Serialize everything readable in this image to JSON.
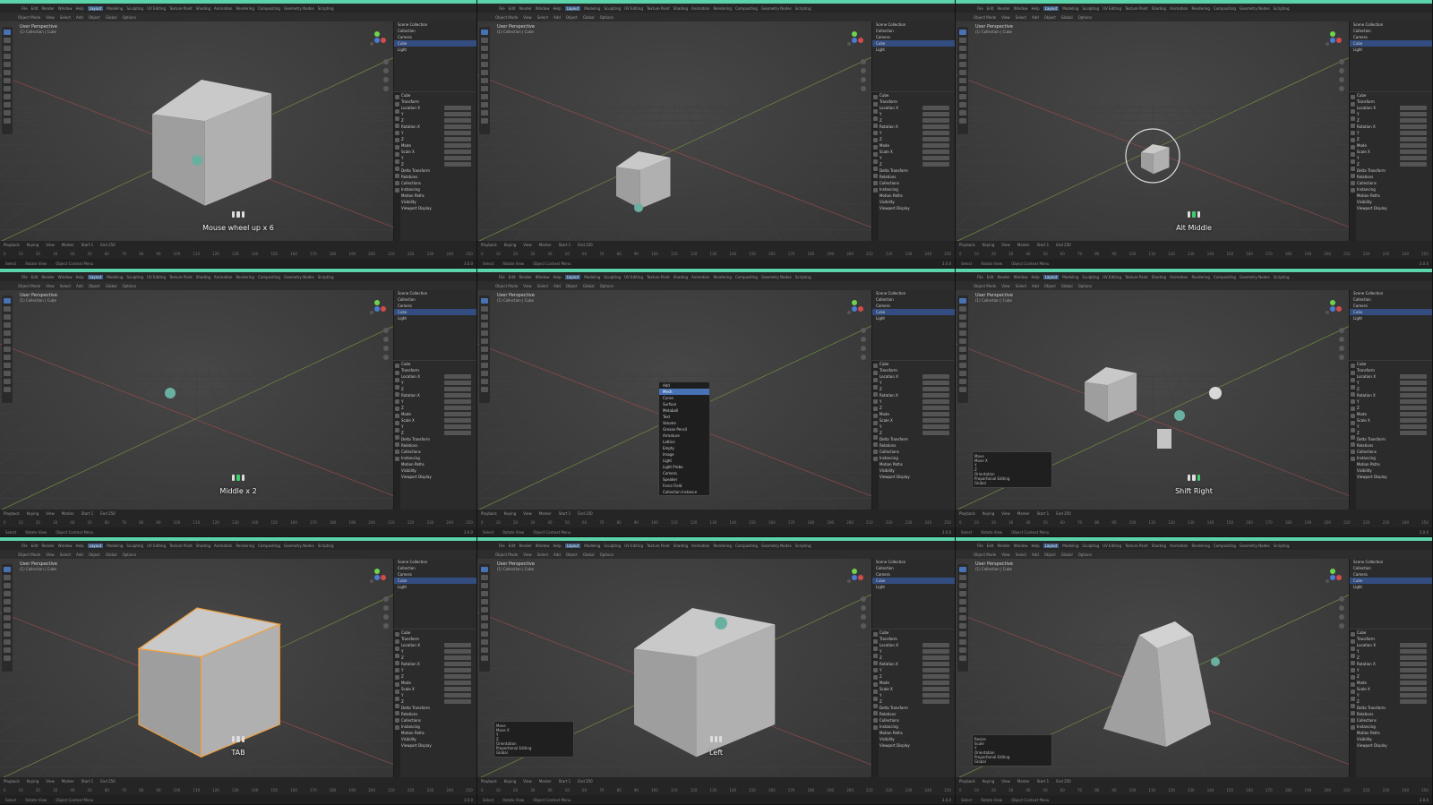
{
  "menus": [
    "File",
    "Edit",
    "Render",
    "Window",
    "Help"
  ],
  "workspaces": [
    "Layout",
    "Modeling",
    "Sculpting",
    "UV Editing",
    "Texture Paint",
    "Shading",
    "Animation",
    "Rendering",
    "Compositing",
    "Geometry Nodes",
    "Scripting"
  ],
  "active_workspace": "Layout",
  "header": {
    "mode": "Object Mode",
    "view": "View",
    "select": "Select",
    "add": "Add",
    "object": "Object",
    "orientation": "Global",
    "options": "Options"
  },
  "viewport": {
    "title": "User Perspective",
    "subtitle": "(1) Collection | Cube"
  },
  "outliner": {
    "header": "Scene Collection",
    "items": [
      "Collection",
      "Camera",
      "Cube",
      "Light"
    ]
  },
  "properties": {
    "object_name": "Cube",
    "section": "Transform",
    "rows": [
      "Location X",
      "Y",
      "Z",
      "Rotation X",
      "Y",
      "Z",
      "Mode",
      "Scale X",
      "Y",
      "Z"
    ],
    "subsections": [
      "Delta Transform",
      "Relations",
      "Collections",
      "Instancing",
      "Motion Paths",
      "Visibility",
      "Viewport Display"
    ]
  },
  "timeline": {
    "items": [
      "Playback",
      "Keying",
      "View",
      "Marker"
    ],
    "start": "Start 1",
    "end": "End 250",
    "frames": [
      "0",
      "10",
      "20",
      "30",
      "40",
      "50",
      "60",
      "70",
      "80",
      "90",
      "100",
      "110",
      "120",
      "130",
      "140",
      "150",
      "160",
      "170",
      "180",
      "190",
      "200",
      "210",
      "220",
      "230",
      "240",
      "250"
    ]
  },
  "statusbar": {
    "select": "Select",
    "rotate": "Rotate View",
    "context": "Object Context Menu",
    "version": "3.0.0"
  },
  "key_captions": {
    "p1": "Mouse wheel up x 6",
    "p3": "Alt Middle",
    "p4": "Middle x 2",
    "p6": "Shift Right",
    "p7": "TAB",
    "p8": "Left"
  },
  "add_menu": {
    "title": "Add",
    "items": [
      "Mesh",
      "Curve",
      "Surface",
      "Metaball",
      "Text",
      "Volume",
      "Grease Pencil",
      "Armature",
      "Lattice",
      "Empty",
      "Image",
      "Light",
      "Light Probe",
      "Camera",
      "Speaker",
      "Force Field",
      "Collection Instance"
    ]
  },
  "op_panels": {
    "cylinder": {
      "title": "Move",
      "labels": [
        "Move X",
        "Y",
        "Z",
        "Orientation",
        "Proportional Editing"
      ],
      "orientation": "Global"
    },
    "extrude": {
      "title": "Move",
      "labels": [
        "Move X",
        "Y",
        "Z",
        "Orientation",
        "Proportional Editing"
      ],
      "orientation": "Global"
    },
    "scale": {
      "title": "Resize",
      "labels": [
        "Scale",
        "Y",
        "Orientation",
        "Proportional Editing"
      ],
      "orientation": "Global"
    }
  },
  "colors": {
    "accent_bar": "#5bd4a9",
    "selection": "#4772b3",
    "active_outline": "#f0a040",
    "mouse_highlight": "#3ccd6e"
  }
}
